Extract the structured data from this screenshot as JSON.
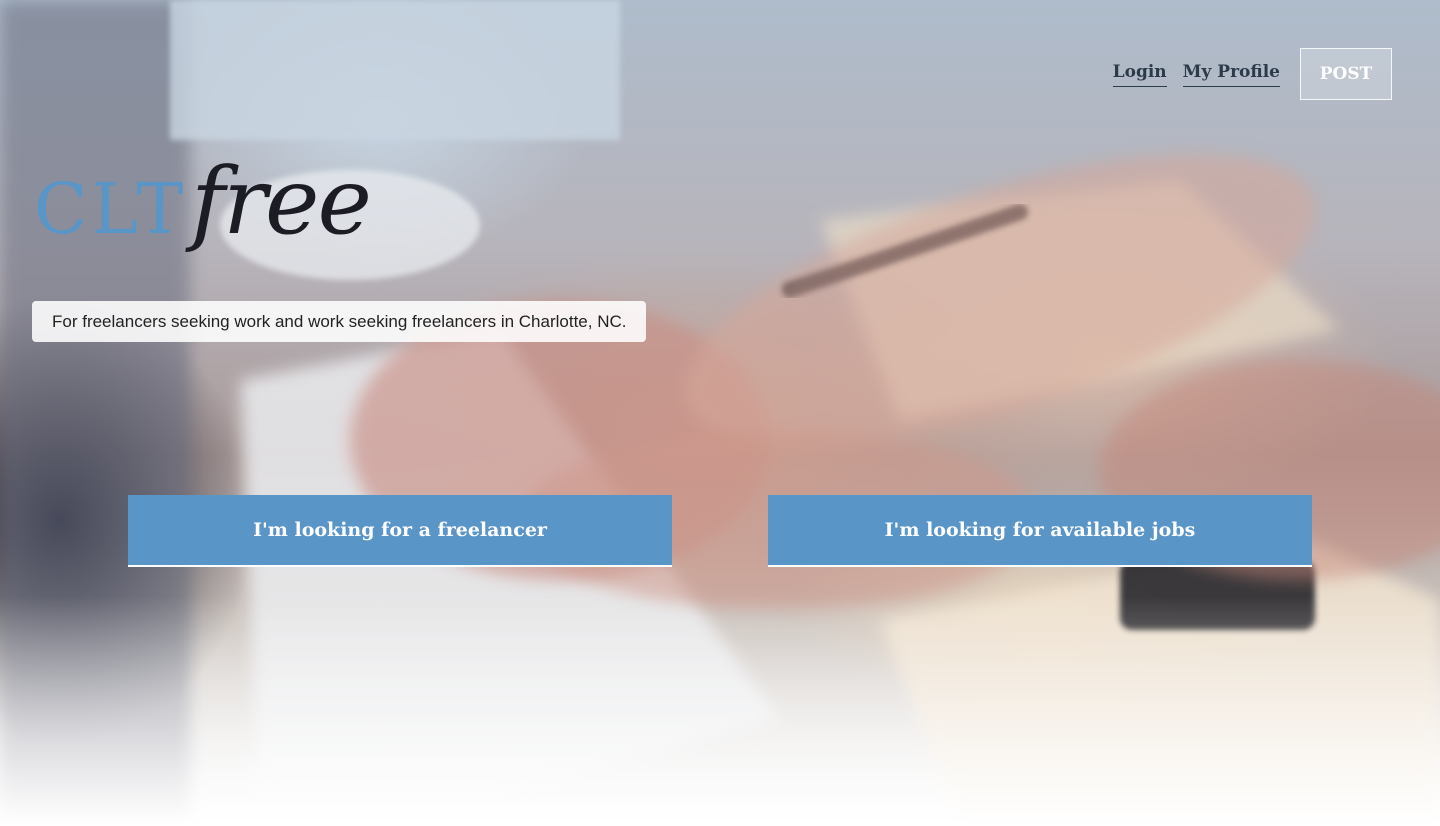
{
  "nav": {
    "login_label": "Login",
    "profile_label": "My Profile",
    "post_label": "POST"
  },
  "logo": {
    "part1": "CLT",
    "part2": "free"
  },
  "hero": {
    "tagline": "For freelancers seeking work and work seeking freelancers in Charlotte, NC.",
    "cta_freelancer": "I'm looking for a freelancer",
    "cta_jobs": "I'm looking for available jobs"
  },
  "colors": {
    "accent": "#5a95c8",
    "nav_text": "#2c3b4a"
  }
}
